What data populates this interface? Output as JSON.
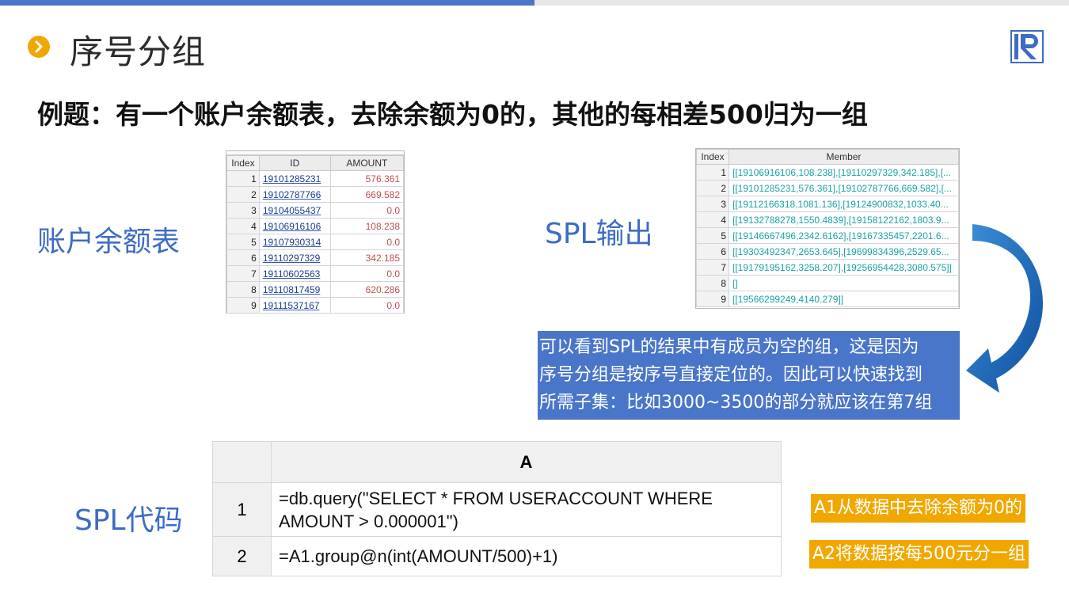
{
  "slide": {
    "title": "序号分组",
    "question": "例题：有一个账户余额表，去除余额为0的，其他的每相差500归为一组",
    "colors": {
      "accent_blue": "#4a76c9",
      "accent_orange": "#f0a800",
      "label_blue": "#3d6cc4",
      "amount_red": "#c0504d",
      "member_teal": "#1aa3a3"
    }
  },
  "labels": {
    "account_table": "账户余额表",
    "spl_output": "SPL输出",
    "spl_code": "SPL代码"
  },
  "account_table": {
    "headers": [
      "Index",
      "ID",
      "AMOUNT"
    ],
    "rows": [
      [
        "1",
        "19101285231",
        "576.361"
      ],
      [
        "2",
        "19102787766",
        "669.582"
      ],
      [
        "3",
        "19104055437",
        "0.0"
      ],
      [
        "4",
        "19106916106",
        "108.238"
      ],
      [
        "5",
        "19107930314",
        "0.0"
      ],
      [
        "6",
        "19110297329",
        "342.185"
      ],
      [
        "7",
        "19110602563",
        "0.0"
      ],
      [
        "8",
        "19110817459",
        "620.286"
      ],
      [
        "9",
        "19111537167",
        "0.0"
      ]
    ]
  },
  "output_table": {
    "headers": [
      "Index",
      "Member"
    ],
    "rows": [
      [
        "1",
        "[[19106916106,108.238],[19110297329,342.185],[..."
      ],
      [
        "2",
        "[[19101285231,576.361],[19102787766,669.582],[..."
      ],
      [
        "3",
        "[[19112166318,1081.136],[19124900832,1033.40..."
      ],
      [
        "4",
        "[[19132788278,1550.4839],[19158122162,1803.9..."
      ],
      [
        "5",
        "[[19146667496,2342.6162],[19167335457,2201.6..."
      ],
      [
        "6",
        "[[19303492347,2653.645],[19699834396,2529.65..."
      ],
      [
        "7",
        "[[19179195162,3258.207],[19256954428,3080.575]]"
      ],
      [
        "8",
        "[]"
      ],
      [
        "9",
        "[[19566299249,4140.279]]"
      ]
    ]
  },
  "note": {
    "lines": [
      "可以看到SPL的结果中有成员为空的组，这是因为",
      "序号分组是按序号直接定位的。因此可以快速找到",
      "所需子集：比如3000~3500的部分就应该在第7组"
    ]
  },
  "code": {
    "column_header": "A",
    "rows": [
      {
        "num": "1",
        "line1": "=db.query(\"SELECT * FROM USERACCOUNT WHERE",
        "line2": "AMOUNT > 0.000001\")"
      },
      {
        "num": "2",
        "line1": "=A1.group@n(int(AMOUNT/500)+1)",
        "line2": ""
      }
    ]
  },
  "tags": {
    "a1": "A1从数据中去除余额为0的",
    "a2": "A2将数据按每500元分一组"
  },
  "icons": {
    "bullet": "chevron-right-icon",
    "logo": "r-logo-icon",
    "arrow": "curved-arrow-icon"
  }
}
